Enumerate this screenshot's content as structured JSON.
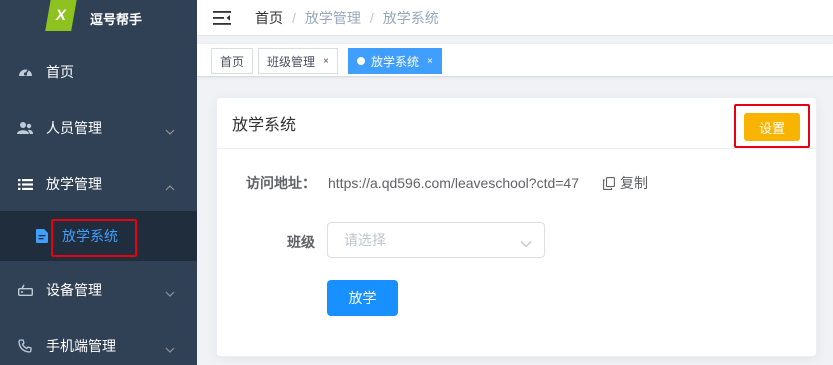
{
  "app": {
    "logo_text": "逗号帮手",
    "logo_mark": "X"
  },
  "sidebar": {
    "items": [
      {
        "label": "首页",
        "icon": "dashboard-icon"
      },
      {
        "label": "人员管理",
        "icon": "people-icon"
      },
      {
        "label": "放学管理",
        "icon": "list-icon"
      },
      {
        "label": "设备管理",
        "icon": "device-icon"
      },
      {
        "label": "手机端管理",
        "icon": "phone-icon"
      }
    ],
    "sub_item": {
      "label": "放学系统",
      "icon": "document-icon"
    }
  },
  "breadcrumb": [
    "首页",
    "放学管理",
    "放学系统"
  ],
  "tags": [
    {
      "label": "首页"
    },
    {
      "label": "班级管理",
      "close": "×"
    },
    {
      "label": "放学系统",
      "close": "×"
    }
  ],
  "card": {
    "title": "放学系统",
    "settings_label": "设置",
    "url_label": "访问地址：",
    "url_value": "https://a.qd596.com/leaveschool?ctd=47",
    "copy_label": "复制",
    "class_label": "班级",
    "class_placeholder": "请选择",
    "submit_label": "放学"
  },
  "colors": {
    "sidebar_bg": "#304156",
    "accent": "#409eff",
    "warning": "#f8b400",
    "highlight": "#e60012"
  }
}
